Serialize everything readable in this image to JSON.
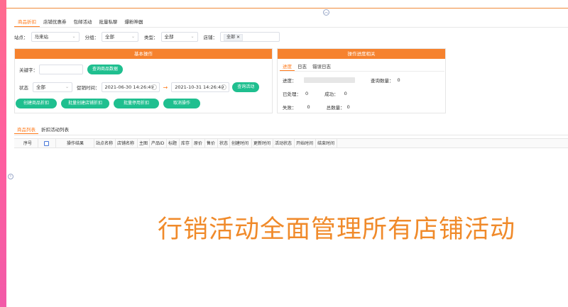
{
  "main_tabs": [
    "商品折扣",
    "店铺优惠券",
    "包邮活动",
    "批量私聊",
    "爆粉神器"
  ],
  "filters": {
    "site_label": "站点：",
    "site_value": "马来站",
    "group_label": "分组：",
    "group_value": "全部",
    "type_label": "类型：",
    "type_value": "全部",
    "shop_label": "店铺：",
    "shop_tag": "全部"
  },
  "basic_panel": {
    "title": "基本操作",
    "keyword_label": "关键字：",
    "keyword_value": "",
    "query_button": "查询商品数据",
    "status_label": "状态",
    "status_value": "全部",
    "promo_time_label": "促销时间：",
    "start_time": "2021-06-30 14:26:49",
    "range_sep": "→",
    "end_time": "2021-10-31 14:26:49",
    "query_activity_button": "查询活动",
    "actions": [
      "创建商品折扣",
      "批量创建店铺折扣",
      "批量停用折扣",
      "取消操作"
    ]
  },
  "progress_panel": {
    "title": "操作进度相关",
    "tabs": [
      "进度",
      "日志",
      "错误日志"
    ],
    "progress_label": "进度：",
    "query_count_label": "查询数量：",
    "query_count": "0",
    "processed_label": "已处理：",
    "processed": "0",
    "success_label": "成功：",
    "success": "0",
    "failed_label": "失败：",
    "failed": "0",
    "total_label": "总数量：",
    "total": "0",
    "progress_value": 0
  },
  "list_tabs": [
    "商品列表",
    "折扣活动列表"
  ],
  "table_columns": [
    "序号",
    "操作结果",
    "站点名称",
    "店铺名称",
    "主图",
    "产品ID",
    "标题",
    "库存",
    "原价",
    "售价",
    "状态",
    "创建时间",
    "更新时间",
    "活动状态",
    "开始时间",
    "结束时间"
  ],
  "promo_text": "行销活动全面管理所有店铺活动",
  "colors": {
    "accent": "#f6822e",
    "button": "#1fbf8f",
    "sidebar": "#ff5f9e"
  },
  "icons": {
    "collapse_top": "chevron-up-icon",
    "collapse_left": "chevron-right-icon"
  }
}
